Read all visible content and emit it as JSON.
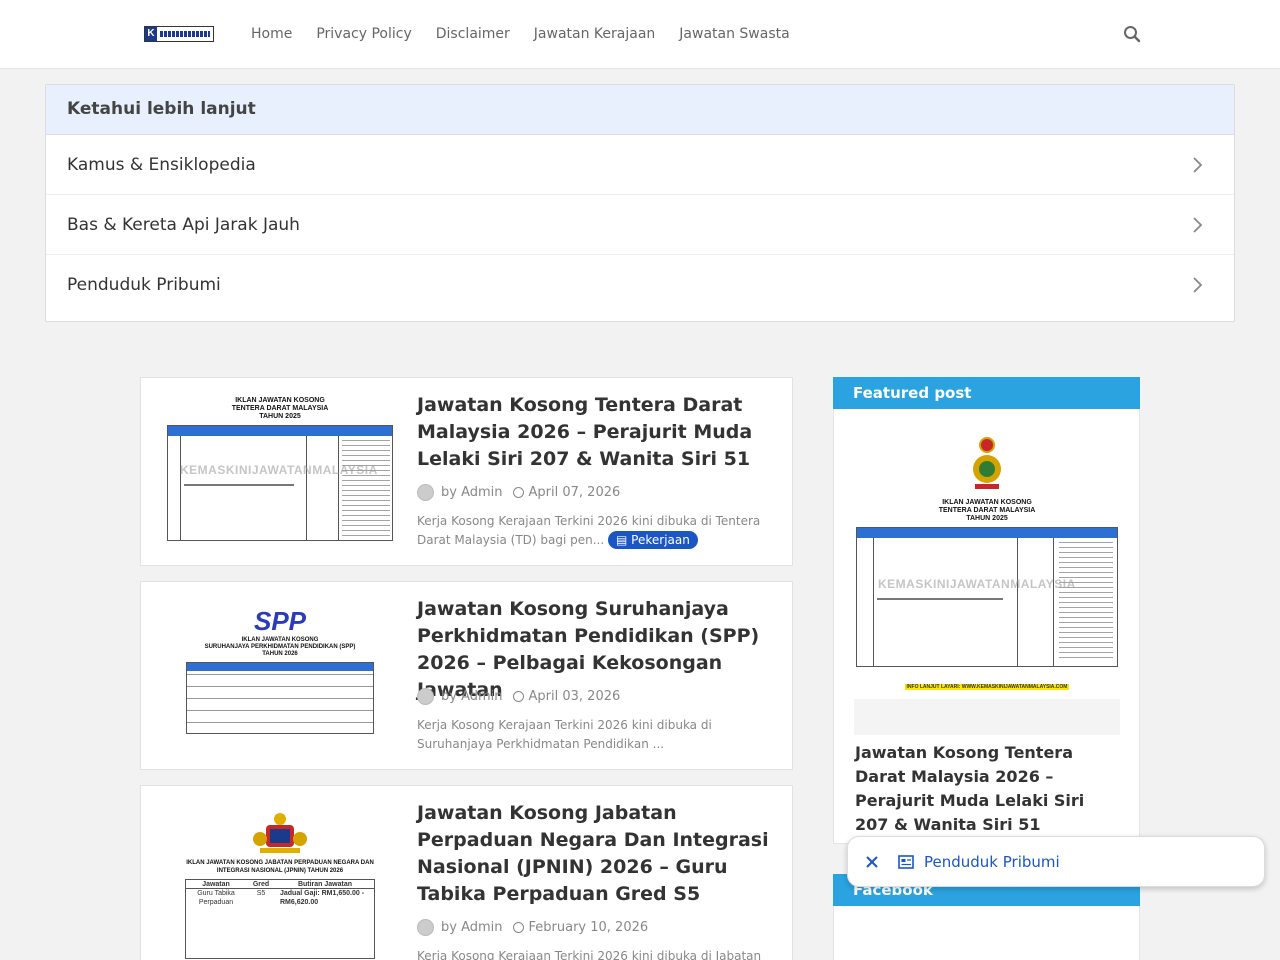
{
  "header": {
    "logo_icon": "kemaskini-logo",
    "nav": [
      "Home",
      "Privacy Policy",
      "Disclaimer",
      "Jawatan Kerajaan",
      "Jawatan Swasta"
    ],
    "search_icon": "search-icon"
  },
  "knowledge_panel": {
    "title": "Ketahui lebih lanjut",
    "items": [
      "Kamus & Ensiklopedia",
      "Bas & Kereta Api Jarak Jauh",
      "Penduduk Pribumi"
    ]
  },
  "posts": [
    {
      "title": "Jawatan Kosong Tentera Darat Malaysia 2026 – Perajurit Muda Lelaki Siri 207 & Wanita Siri 51",
      "author": "by Admin",
      "date": "April 07, 2026",
      "snippet": "Kerja Kosong Kerajaan Terkini 2026 kini dibuka di Tentera Darat Malaysia (TD) bagi pen...",
      "tag": "Pekerjaan",
      "thumb": {
        "heading": [
          "IKLAN JAWATAN KOSONG",
          "TENTERA DARAT MALAYSIA",
          "TAHUN 2025"
        ],
        "watermark": "KEMASKINIJAWATANMALAYSIA"
      }
    },
    {
      "title": "Jawatan Kosong Suruhanjaya Perkhidmatan Pendidikan (SPP) 2026 – Pelbagai Kekosongan Jawatan",
      "author": "by Admin",
      "date": "April 03, 2026",
      "snippet": "Kerja Kosong Kerajaan Terkini 2026 kini dibuka di Suruhanjaya Perkhidmatan Pendidikan ...",
      "thumb": {
        "logo": "SPP",
        "heading": [
          "IKLAN JAWATAN KOSONG",
          "SURUHANJAYA PERKHIDMATAN PENDIDIKAN (SPP)",
          "TAHUN 2026"
        ]
      }
    },
    {
      "title": "Jawatan Kosong Jabatan Perpaduan Negara Dan Integrasi Nasional (JPNIN) 2026 – Guru Tabika Perpaduan Gred S5",
      "author": "by Admin",
      "date": "February 10, 2026",
      "snippet": "Kerja Kosong Kerajaan Terkini 2026 kini dibuka di Jabatan",
      "thumb": {
        "heading": [
          "IKLAN JAWATAN KOSONG JABATAN PERPADUAN NEGARA DAN",
          "INTEGRASI NASIONAL (JPNIN) TAHUN 2026"
        ],
        "cols": [
          "Jawatan",
          "Gred",
          "Butiran Jawatan"
        ],
        "row": [
          "Guru Tabika Perpaduan",
          "S5",
          "Jadual Gaji: RM1,650.00 - RM6,620.00"
        ]
      }
    }
  ],
  "sidebar": {
    "featured_heading": "Featured post",
    "featured_title": "Jawatan Kosong Tentera Darat Malaysia 2026 – Perajurit Muda Lelaki Siri 207 & Wanita Siri 51",
    "featured_img": {
      "heading": [
        "IKLAN JAWATAN KOSONG",
        "TENTERA DARAT MALAYSIA",
        "TAHUN 2025"
      ],
      "watermark": "KEMASKINIJAWATANMALAYSIA",
      "footer": "INFO LANJUT LAYARI: WWW.KEMASKINIJAWATANMALAYSIA.COM"
    },
    "facebook_heading": "Facebook"
  },
  "chip": {
    "label": "Penduduk Pribumi",
    "close_icon": "close-icon",
    "news_icon": "news-icon"
  },
  "colors": {
    "accent": "#2aa3e0",
    "link": "#1a56c4",
    "panel_head": "#e8f0fe"
  }
}
